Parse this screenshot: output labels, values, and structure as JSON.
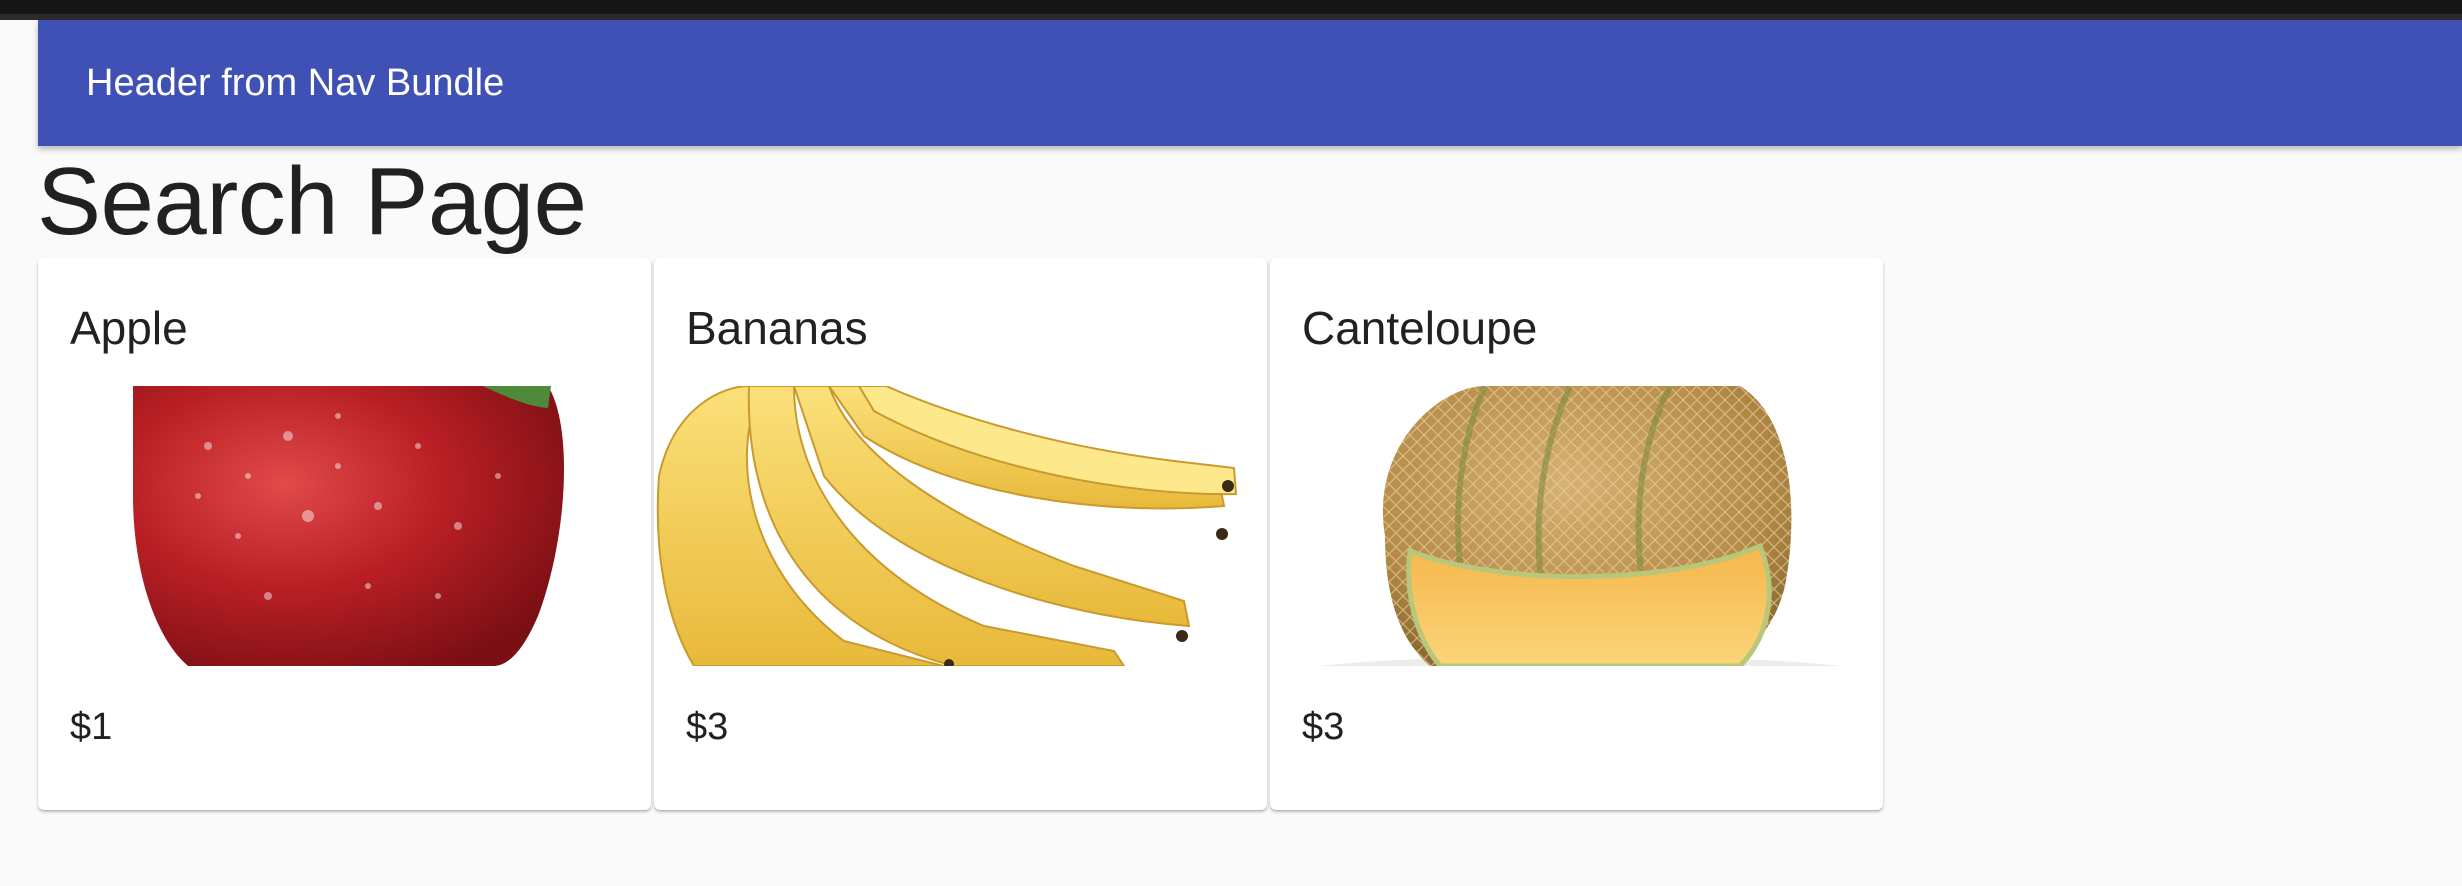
{
  "toolbar": {
    "title": "Header from Nav Bundle"
  },
  "page": {
    "title": "Search Page"
  },
  "products": [
    {
      "name": "Apple",
      "price": "$1",
      "image": "apple-image"
    },
    {
      "name": "Bananas",
      "price": "$3",
      "image": "bananas-image"
    },
    {
      "name": "Canteloupe",
      "price": "$3",
      "image": "canteloupe-image"
    }
  ],
  "colors": {
    "primary": "#3f51b5",
    "background": "#fafafa",
    "card": "#ffffff",
    "text": "#212121"
  }
}
